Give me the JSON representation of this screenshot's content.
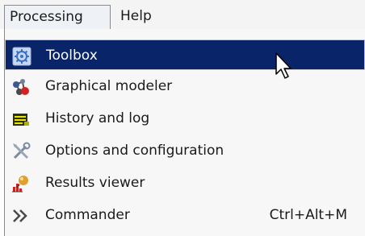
{
  "menubar": {
    "processing_label": "Processing",
    "help_label": "Help"
  },
  "menu": {
    "items": [
      {
        "label": "Toolbox",
        "icon": "gear-icon",
        "highlighted": true
      },
      {
        "label": "Graphical modeler",
        "icon": "modeler-icon"
      },
      {
        "label": "History and log",
        "icon": "history-icon"
      },
      {
        "label": "Options and configuration",
        "icon": "tools-icon"
      },
      {
        "label": "Results viewer",
        "icon": "results-icon"
      },
      {
        "label": "Commander",
        "icon": "chevrons-icon",
        "shortcut": "Ctrl+Alt+M"
      }
    ]
  },
  "colors": {
    "highlight": "#0a246a",
    "menu_bg": "#f7f7f7"
  }
}
